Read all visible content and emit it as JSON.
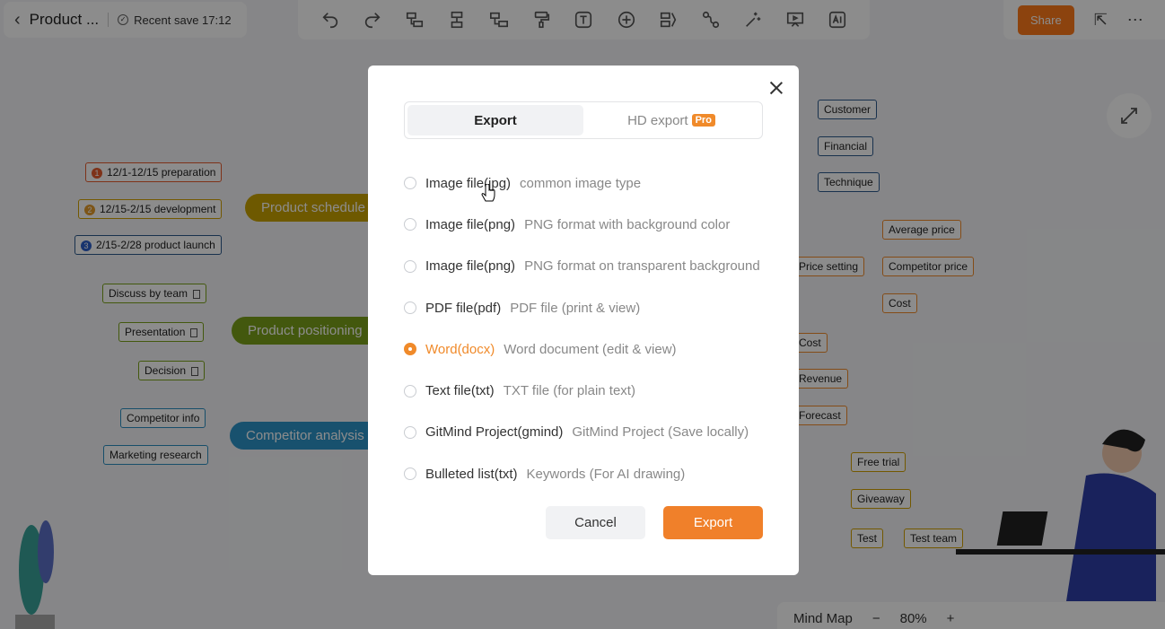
{
  "header": {
    "title": "Product ...",
    "save_status": "Recent save 17:12"
  },
  "toolbar": {
    "tools": [
      "undo-icon",
      "redo-icon",
      "insert-child-icon",
      "insert-sibling-icon",
      "insert-parent-icon",
      "format-painter-icon",
      "text-icon",
      "add-icon",
      "summary-icon",
      "relation-icon",
      "magic-icon",
      "presentation-icon",
      "ai-icon"
    ]
  },
  "top_right": {
    "share_label": "Share"
  },
  "mindmap": {
    "branches": {
      "schedule": "Product schedule",
      "positioning": "Product positioning",
      "competitor": "Competitor analysis"
    },
    "schedule_items": [
      "12/1-12/15 preparation",
      "12/15-2/15 development",
      "2/15-2/28 product launch"
    ],
    "schedule_nums": [
      "1",
      "2",
      "3"
    ],
    "positioning_items": [
      "Discuss by team",
      "Presentation",
      "Decision"
    ],
    "competitor_items": [
      "Competitor info",
      "Marketing research"
    ],
    "right_top": [
      "Customer",
      "Financial",
      "Technique"
    ],
    "price_setting": "Price setting",
    "price_items": [
      "Average price",
      "Competitor price",
      "Cost"
    ],
    "finance_items": [
      "Cost",
      "Revenue",
      "Forecast"
    ],
    "promo_items": [
      "Free trial",
      "Giveaway",
      "Test"
    ],
    "test_team": "Test team"
  },
  "bottombar": {
    "view_mode": "Mind Map",
    "zoom": "80%"
  },
  "export_dialog": {
    "tabs": {
      "export": "Export",
      "hd_export": "HD export",
      "pro_badge": "Pro"
    },
    "options": [
      {
        "name": "Image file(jpg)",
        "desc": "common image type",
        "selected": false
      },
      {
        "name": "Image file(png)",
        "desc": "PNG format with background color",
        "selected": false
      },
      {
        "name": "Image file(png)",
        "desc": "PNG format on transparent background",
        "selected": false
      },
      {
        "name": "PDF file(pdf)",
        "desc": "PDF file (print & view)",
        "selected": false
      },
      {
        "name": "Word(docx)",
        "desc": "Word document (edit & view)",
        "selected": true
      },
      {
        "name": "Text file(txt)",
        "desc": "TXT file (for plain text)",
        "selected": false
      },
      {
        "name": "GitMind Project(gmind)",
        "desc": "GitMind Project (Save locally)",
        "selected": false
      },
      {
        "name": "Bulleted list(txt)",
        "desc": "Keywords (For AI drawing)",
        "selected": false
      }
    ],
    "cancel_label": "Cancel",
    "export_label": "Export"
  },
  "colors": {
    "accent": "#f08a2a",
    "schedule": "#c9a300",
    "positioning": "#7ba11a",
    "competitor": "#2d94c9"
  }
}
